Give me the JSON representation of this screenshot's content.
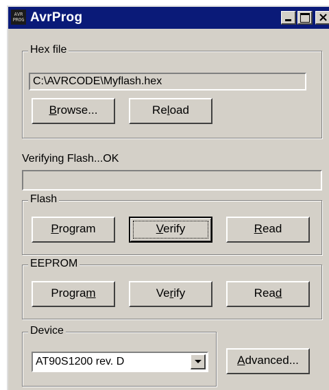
{
  "window": {
    "title": "AvrProg",
    "icon_text": [
      "AVR",
      "PROG"
    ],
    "close_glyph": "×"
  },
  "hexfile": {
    "group_label": "Hex file",
    "path": "C:\\AVRCODE\\Myflash.hex",
    "browse": {
      "pre": "",
      "key": "B",
      "post": "rowse..."
    },
    "reload": {
      "pre": "Re",
      "key": "l",
      "post": "oad"
    }
  },
  "status": {
    "text": "Verifying Flash...OK",
    "progress": 0
  },
  "flash": {
    "group_label": "Flash",
    "program": {
      "pre": "",
      "key": "P",
      "post": "rogram"
    },
    "verify": {
      "pre": "",
      "key": "V",
      "post": "erify"
    },
    "read": {
      "pre": "",
      "key": "R",
      "post": "ead"
    }
  },
  "eeprom": {
    "group_label": "EEPROM",
    "program": {
      "pre": "Progra",
      "key": "m",
      "post": ""
    },
    "verify": {
      "pre": "Ve",
      "key": "r",
      "post": "ify"
    },
    "read": {
      "pre": "Rea",
      "key": "d",
      "post": ""
    }
  },
  "device": {
    "group_label": "Device",
    "selected": "AT90S1200 rev. D",
    "advanced": {
      "pre": "",
      "key": "A",
      "post": "dvanced..."
    }
  },
  "colors": {
    "titlebar": "#0a1a78",
    "face": "#d4d0c8",
    "shadow": "#808080",
    "highlight": "#ffffff"
  },
  "icons": [
    "app-icon",
    "minimize-icon",
    "maximize-icon",
    "close-icon",
    "dropdown-arrow-icon"
  ]
}
